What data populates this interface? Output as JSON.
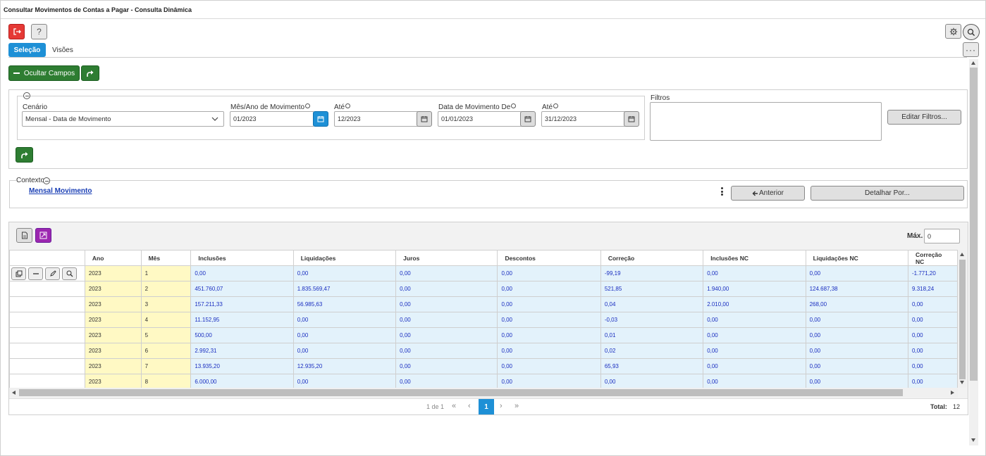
{
  "window": {
    "title": "Consultar Movimentos de Contas a Pagar - Consulta Dinâmica"
  },
  "toolbar": {
    "help_label": "?",
    "more_label": "···"
  },
  "tabs": [
    {
      "label": "Seleção",
      "active": true
    },
    {
      "label": "Visões",
      "active": false
    }
  ],
  "actions": {
    "hide_fields_label": "Ocultar Campos"
  },
  "filters": {
    "cenario": {
      "label": "Cenário",
      "value": "Mensal - Data de Movimento"
    },
    "mes_ano_de": {
      "label": "Mês/Ano de Movimento",
      "value": "01/2023"
    },
    "mes_ano_ate": {
      "label": "Até",
      "value": "12/2023"
    },
    "data_de": {
      "label": "Data de Movimento De",
      "value": "01/01/2023"
    },
    "data_ate": {
      "label": "Até",
      "value": "31/12/2023"
    },
    "filtros": {
      "label": "Filtros",
      "edit_label": "Editar Filtros..."
    }
  },
  "context": {
    "label": "Contexto",
    "link": "Mensal Movimento",
    "prev_label": "Anterior",
    "detail_label": "Detalhar Por..."
  },
  "grid": {
    "max_label": "Máx.",
    "max_value": "0",
    "columns": [
      "Ano",
      "Mês",
      "Inclusões",
      "Liquidações",
      "Juros",
      "Descontos",
      "Correção",
      "Inclusões NC",
      "Liquidações NC",
      "Correção NC"
    ],
    "rows": [
      [
        "2023",
        "1",
        "0,00",
        "0,00",
        "0,00",
        "0,00",
        "-99,19",
        "0,00",
        "0,00",
        "-1.771,20"
      ],
      [
        "2023",
        "2",
        "451.760,07",
        "1.835.569,47",
        "0,00",
        "0,00",
        "521,85",
        "1.940,00",
        "124.687,38",
        "9.318,24"
      ],
      [
        "2023",
        "3",
        "157.211,33",
        "56.985,63",
        "0,00",
        "0,00",
        "0,04",
        "2.010,00",
        "268,00",
        "0,00"
      ],
      [
        "2023",
        "4",
        "11.152,95",
        "0,00",
        "0,00",
        "0,00",
        "-0,03",
        "0,00",
        "0,00",
        "0,00"
      ],
      [
        "2023",
        "5",
        "500,00",
        "0,00",
        "0,00",
        "0,00",
        "0,01",
        "0,00",
        "0,00",
        "0,00"
      ],
      [
        "2023",
        "6",
        "2.992,31",
        "0,00",
        "0,00",
        "0,00",
        "0,02",
        "0,00",
        "0,00",
        "0,00"
      ],
      [
        "2023",
        "7",
        "13.935,20",
        "12.935,20",
        "0,00",
        "0,00",
        "65,93",
        "0,00",
        "0,00",
        "0,00"
      ],
      [
        "2023",
        "8",
        "6.000,00",
        "0,00",
        "0,00",
        "0,00",
        "0,00",
        "0,00",
        "0,00",
        "0,00"
      ]
    ]
  },
  "pager": {
    "info": "1 de 1",
    "first": "«",
    "prev": "‹",
    "current": "1",
    "next": "›",
    "last": "»",
    "total_label": "Total:",
    "total_value": "12"
  },
  "colors": {
    "accent": "#1e90d6",
    "green": "#2e7d32",
    "exit": "#e53935",
    "purple": "#9c27b0"
  }
}
